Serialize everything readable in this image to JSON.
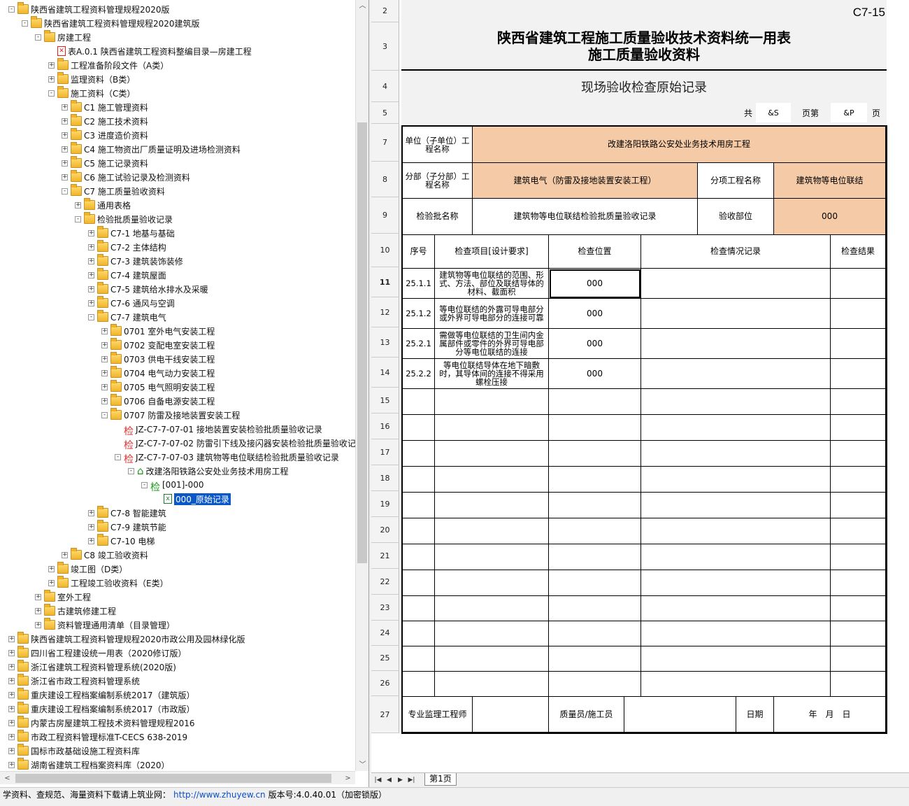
{
  "tree": [
    {
      "depth": 0,
      "icon": "folder",
      "toggle": "-",
      "label": "陕西省建筑工程资料管理规程2020版"
    },
    {
      "depth": 1,
      "icon": "folder",
      "toggle": "-",
      "label": "陕西省建筑工程资料管理规程2020建筑版"
    },
    {
      "depth": 2,
      "icon": "folder",
      "toggle": "-",
      "label": "房建工程"
    },
    {
      "depth": 3,
      "icon": "pdf",
      "toggle": "",
      "label": "表A.0.1 陕西省建筑工程资料整编目录—房建工程"
    },
    {
      "depth": 3,
      "icon": "folder",
      "toggle": "+",
      "label": "工程准备阶段文件（A类）"
    },
    {
      "depth": 3,
      "icon": "folder",
      "toggle": "+",
      "label": "监理资料（B类）"
    },
    {
      "depth": 3,
      "icon": "folder",
      "toggle": "-",
      "label": "施工资料（C类）"
    },
    {
      "depth": 4,
      "icon": "folder",
      "toggle": "+",
      "label": "C1 施工管理资料"
    },
    {
      "depth": 4,
      "icon": "folder",
      "toggle": "+",
      "label": "C2 施工技术资料"
    },
    {
      "depth": 4,
      "icon": "folder",
      "toggle": "+",
      "label": "C3 进度造价资料"
    },
    {
      "depth": 4,
      "icon": "folder",
      "toggle": "+",
      "label": "C4 施工物资出厂质量证明及进场检测资料"
    },
    {
      "depth": 4,
      "icon": "folder",
      "toggle": "+",
      "label": "C5 施工记录资料"
    },
    {
      "depth": 4,
      "icon": "folder",
      "toggle": "+",
      "label": "C6 施工试验记录及检测资料"
    },
    {
      "depth": 4,
      "icon": "folder",
      "toggle": "-",
      "label": "C7 施工质量验收资料"
    },
    {
      "depth": 5,
      "icon": "folder",
      "toggle": "+",
      "label": "通用表格"
    },
    {
      "depth": 5,
      "icon": "folder",
      "toggle": "-",
      "label": "检验批质量验收记录"
    },
    {
      "depth": 6,
      "icon": "folder",
      "toggle": "+",
      "label": "C7-1 地基与基础"
    },
    {
      "depth": 6,
      "icon": "folder",
      "toggle": "+",
      "label": "C7-2 主体结构"
    },
    {
      "depth": 6,
      "icon": "folder",
      "toggle": "+",
      "label": "C7-3 建筑装饰装修"
    },
    {
      "depth": 6,
      "icon": "folder",
      "toggle": "+",
      "label": "C7-4 建筑屋面"
    },
    {
      "depth": 6,
      "icon": "folder",
      "toggle": "+",
      "label": "C7-5 建筑给水排水及采暖"
    },
    {
      "depth": 6,
      "icon": "folder",
      "toggle": "+",
      "label": "C7-6 通风与空调"
    },
    {
      "depth": 6,
      "icon": "folder",
      "toggle": "-",
      "label": "C7-7 建筑电气"
    },
    {
      "depth": 7,
      "icon": "folder",
      "toggle": "+",
      "label": "0701 室外电气安装工程"
    },
    {
      "depth": 7,
      "icon": "folder",
      "toggle": "+",
      "label": "0702 变配电室安装工程"
    },
    {
      "depth": 7,
      "icon": "folder",
      "toggle": "+",
      "label": "0703 供电干线安装工程"
    },
    {
      "depth": 7,
      "icon": "folder",
      "toggle": "+",
      "label": "0704 电气动力安装工程"
    },
    {
      "depth": 7,
      "icon": "folder",
      "toggle": "+",
      "label": "0705 电气照明安装工程"
    },
    {
      "depth": 7,
      "icon": "folder",
      "toggle": "+",
      "label": "0706 自备电源安装工程"
    },
    {
      "depth": 7,
      "icon": "folder",
      "toggle": "-",
      "label": "0707 防雷及接地装置安装工程"
    },
    {
      "depth": 8,
      "icon": "jian",
      "toggle": "",
      "label": "JZ-C7-7-07-01 接地装置安装检验批质量验收记录"
    },
    {
      "depth": 8,
      "icon": "jian",
      "toggle": "",
      "label": "JZ-C7-7-07-02 防雷引下线及接闪器安装检验批质量验收记录"
    },
    {
      "depth": 8,
      "icon": "jian",
      "toggle": "-",
      "label": "JZ-C7-7-07-03 建筑物等电位联结检验批质量验收记录"
    },
    {
      "depth": 9,
      "icon": "house",
      "toggle": "-",
      "label": "改建洛阳铁路公安处业务技术用房工程"
    },
    {
      "depth": 10,
      "icon": "jiang",
      "toggle": "-",
      "label": "[001]-000"
    },
    {
      "depth": 11,
      "icon": "xls",
      "toggle": "",
      "label": "000_原始记录",
      "selected": true
    },
    {
      "depth": 6,
      "icon": "folder",
      "toggle": "+",
      "label": "C7-8 智能建筑"
    },
    {
      "depth": 6,
      "icon": "folder",
      "toggle": "+",
      "label": "C7-9 建筑节能"
    },
    {
      "depth": 6,
      "icon": "folder",
      "toggle": "+",
      "label": "C7-10 电梯"
    },
    {
      "depth": 4,
      "icon": "folder",
      "toggle": "+",
      "label": "C8 竣工验收资料"
    },
    {
      "depth": 3,
      "icon": "folder",
      "toggle": "+",
      "label": "竣工图（D类）"
    },
    {
      "depth": 3,
      "icon": "folder",
      "toggle": "+",
      "label": "工程竣工验收资料（E类）"
    },
    {
      "depth": 2,
      "icon": "folder",
      "toggle": "+",
      "label": "室外工程"
    },
    {
      "depth": 2,
      "icon": "folder",
      "toggle": "+",
      "label": "古建筑修建工程"
    },
    {
      "depth": 2,
      "icon": "folder",
      "toggle": "+",
      "label": "资料管理通用清单（目录管理）"
    },
    {
      "depth": 0,
      "icon": "folder",
      "toggle": "+",
      "label": "陕西省建筑工程资料管理规程2020市政公用及园林绿化版"
    },
    {
      "depth": 0,
      "icon": "folder",
      "toggle": "+",
      "label": "四川省工程建设统一用表（2020修订版）"
    },
    {
      "depth": 0,
      "icon": "folder",
      "toggle": "+",
      "label": "浙江省建筑工程资料管理系统(2020版)"
    },
    {
      "depth": 0,
      "icon": "folder",
      "toggle": "+",
      "label": "浙江省市政工程资料管理系统"
    },
    {
      "depth": 0,
      "icon": "folder",
      "toggle": "+",
      "label": "重庆建设工程档案编制系统2017（建筑版）"
    },
    {
      "depth": 0,
      "icon": "folder",
      "toggle": "+",
      "label": "重庆建设工程档案编制系统2017（市政版）"
    },
    {
      "depth": 0,
      "icon": "folder",
      "toggle": "+",
      "label": "内蒙古房屋建筑工程技术资料管理规程2016"
    },
    {
      "depth": 0,
      "icon": "folder",
      "toggle": "+",
      "label": "市政工程资料管理标准T-CECS 638-2019"
    },
    {
      "depth": 0,
      "icon": "folder",
      "toggle": "+",
      "label": "国标市政基础设施工程资料库"
    },
    {
      "depth": 0,
      "icon": "folder",
      "toggle": "+",
      "label": "湖南省建筑工程档案资料库（2020）"
    }
  ],
  "form": {
    "code": "C7-15",
    "title1": "陕西省建筑工程施工质量验收技术资料统一用表",
    "title2": "施工质量验收资料",
    "subtitle": "现场验收检查原始记录",
    "page_total_label": "共",
    "page_total_value": "&S",
    "page_no_label": "页第",
    "page_no_value": "&P",
    "page_suffix": "页",
    "unit_label": "单位（子单位）工程名称",
    "unit_value": "改建洛阳铁路公安处业务技术用房工程",
    "division_label": "分部（子分部）工程名称",
    "division_value": "建筑电气（防雷及接地装置安装工程）",
    "subitem_label": "分项工程名称",
    "subitem_value": "建筑物等电位联结",
    "batch_label": "检验批名称",
    "batch_value": "建筑物等电位联结检验批质量验收记录",
    "location_label": "验收部位",
    "location_value": "000",
    "col_seq": "序号",
    "col_item": "检查项目[设计要求]",
    "col_pos": "检查位置",
    "col_record": "检查情况记录",
    "col_result": "检查结果",
    "rows": [
      {
        "seq": "25.1.1",
        "item": "建筑物等电位联结的范围、形式、方法、部位及联结导体的材料、截面积",
        "pos": "000"
      },
      {
        "seq": "25.1.2",
        "item": "等电位联结的外露可导电部分或外界可导电部分的连接可靠",
        "pos": "000"
      },
      {
        "seq": "25.2.1",
        "item": "需做等电位联结的卫生间内金属部件或零件的外界可导电部分等电位联结的连接",
        "pos": "000"
      },
      {
        "seq": "25.2.2",
        "item": "等电位联结导体在地下暗敷时，其导体间的连接不得采用螺栓压接",
        "pos": "000"
      }
    ],
    "footer_supervisor": "专业监理工程师",
    "footer_qc": "质量员/施工员",
    "footer_date_label": "日期",
    "footer_date_value": "年　月　日"
  },
  "row_numbers": [
    "2",
    "3",
    "4",
    "5",
    "7",
    "8",
    "9",
    "10",
    "11",
    "12",
    "13",
    "14",
    "15",
    "16",
    "17",
    "18",
    "19",
    "20",
    "21",
    "22",
    "23",
    "24",
    "25",
    "26",
    "27"
  ],
  "sheet_tab": "第1页",
  "status": {
    "prefix": "学资料、查规范、海量资料下载请上筑业网：",
    "url": "http://www.zhuyew.cn",
    "version": "版本号:4.0.40.01（加密锁版）"
  }
}
